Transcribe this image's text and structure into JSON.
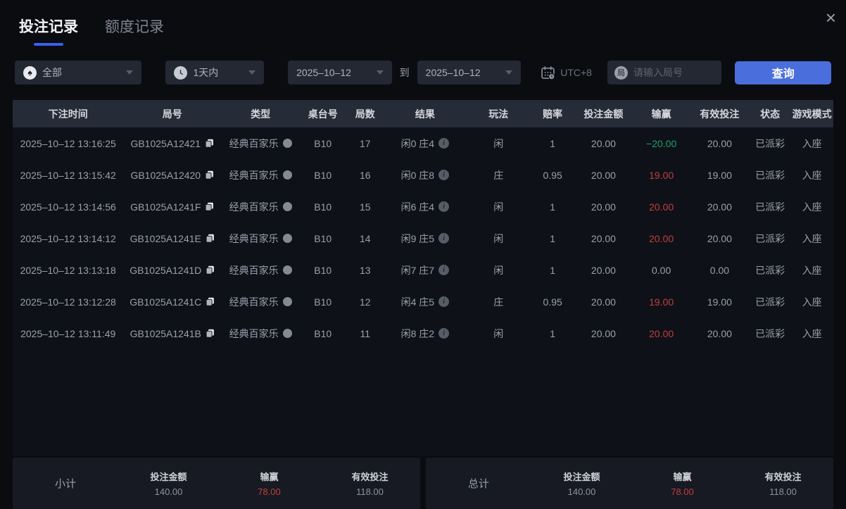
{
  "tabs": [
    {
      "label": "投注记录",
      "active": true
    },
    {
      "label": "额度记录",
      "active": false
    }
  ],
  "close_icon": "×",
  "filters": {
    "game_type_value": "全部",
    "time_range_value": "1天内",
    "date_from": "2025–10–12",
    "to_label": "到",
    "date_to": "2025–10–12",
    "timezone": "UTC+8",
    "round_icon_char": "局",
    "round_placeholder": "请输入局号",
    "query_label": "查询",
    "spade_char": "♠"
  },
  "table": {
    "headers": [
      "下注时间",
      "局号",
      "类型",
      "桌台号",
      "局数",
      "结果",
      "玩法",
      "赔率",
      "投注金额",
      "输赢",
      "有效投注",
      "状态",
      "游戏模式"
    ],
    "rows": [
      {
        "time": "2025–10–12 13:16:25",
        "round": "GB1025A12421",
        "type": "经典百家乐",
        "table_no": "B10",
        "rounds": "17",
        "result": "闲0 庄4",
        "play": "闲",
        "odds": "1",
        "bet": "20.00",
        "winloss": "−20.00",
        "winloss_class": "green",
        "valid": "20.00",
        "status": "已派彩",
        "mode": "入座"
      },
      {
        "time": "2025–10–12 13:15:42",
        "round": "GB1025A12420",
        "type": "经典百家乐",
        "table_no": "B10",
        "rounds": "16",
        "result": "闲0 庄8",
        "play": "庄",
        "odds": "0.95",
        "bet": "20.00",
        "winloss": "19.00",
        "winloss_class": "red",
        "valid": "19.00",
        "status": "已派彩",
        "mode": "入座"
      },
      {
        "time": "2025–10–12 13:14:56",
        "round": "GB1025A1241F",
        "type": "经典百家乐",
        "table_no": "B10",
        "rounds": "15",
        "result": "闲6 庄4",
        "play": "闲",
        "odds": "1",
        "bet": "20.00",
        "winloss": "20.00",
        "winloss_class": "red",
        "valid": "20.00",
        "status": "已派彩",
        "mode": "入座"
      },
      {
        "time": "2025–10–12 13:14:12",
        "round": "GB1025A1241E",
        "type": "经典百家乐",
        "table_no": "B10",
        "rounds": "14",
        "result": "闲9 庄5",
        "play": "闲",
        "odds": "1",
        "bet": "20.00",
        "winloss": "20.00",
        "winloss_class": "red",
        "valid": "20.00",
        "status": "已派彩",
        "mode": "入座"
      },
      {
        "time": "2025–10–12 13:13:18",
        "round": "GB1025A1241D",
        "type": "经典百家乐",
        "table_no": "B10",
        "rounds": "13",
        "result": "闲7 庄7",
        "play": "闲",
        "odds": "1",
        "bet": "20.00",
        "winloss": "0.00",
        "winloss_class": "",
        "valid": "0.00",
        "status": "已派彩",
        "mode": "入座"
      },
      {
        "time": "2025–10–12 13:12:28",
        "round": "GB1025A1241C",
        "type": "经典百家乐",
        "table_no": "B10",
        "rounds": "12",
        "result": "闲4 庄5",
        "play": "庄",
        "odds": "0.95",
        "bet": "20.00",
        "winloss": "19.00",
        "winloss_class": "red",
        "valid": "19.00",
        "status": "已派彩",
        "mode": "入座"
      },
      {
        "time": "2025–10–12 13:11:49",
        "round": "GB1025A1241B",
        "type": "经典百家乐",
        "table_no": "B10",
        "rounds": "11",
        "result": "闲8 庄2",
        "play": "闲",
        "odds": "1",
        "bet": "20.00",
        "winloss": "20.00",
        "winloss_class": "red",
        "valid": "20.00",
        "status": "已派彩",
        "mode": "入座"
      }
    ]
  },
  "summary": {
    "subtotal": {
      "label": "小计",
      "bet_label": "投注金额",
      "bet_value": "140.00",
      "winloss_label": "输赢",
      "winloss_value": "78.00",
      "valid_label": "有效投注",
      "valid_value": "118.00"
    },
    "total": {
      "label": "总计",
      "bet_label": "投注金额",
      "bet_value": "140.00",
      "winloss_label": "输赢",
      "winloss_value": "78.00",
      "valid_label": "有效投注",
      "valid_value": "118.00"
    }
  },
  "colors": {
    "accent_blue": "#4a6edb",
    "tab_underline": "#3c5ef0",
    "win_green": "#21a065",
    "loss_red": "#c43d3d",
    "header_bg": "#262b38",
    "panel_bg": "#171a22"
  }
}
